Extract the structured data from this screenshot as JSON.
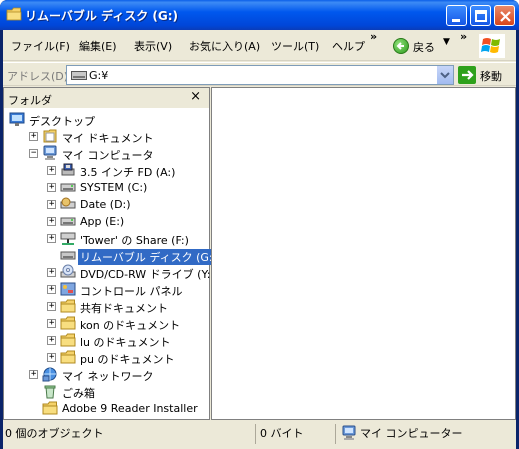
{
  "window": {
    "title": "リムーバブル ディスク (G:)"
  },
  "menu": {
    "items": [
      "ファイル(F)",
      "編集(E)",
      "表示(V)",
      "お気に入り(A)",
      "ツール(T)",
      "ヘルプ"
    ],
    "overflow_glyph": "»",
    "back_label": "戻る"
  },
  "address": {
    "label": "アドレス(D)",
    "value": "G:¥",
    "go_label": "移動"
  },
  "folders": {
    "title": "フォルダ",
    "close_glyph": "×",
    "tree": [
      {
        "label": "デスクトップ",
        "icon": "desktop-icon",
        "expander": ""
      },
      {
        "label": "マイ ドキュメント",
        "icon": "my-documents-icon",
        "expander": "+"
      },
      {
        "label": "マイ コンピュータ",
        "icon": "my-computer-icon",
        "expander": "−"
      },
      {
        "label": "3.5 インチ FD (A:)",
        "icon": "floppy-icon",
        "expander": "+"
      },
      {
        "label": "SYSTEM (C:)",
        "icon": "hard-drive-icon",
        "expander": "+"
      },
      {
        "label": "Date (D:)",
        "icon": "cd-drive-icon",
        "expander": "+"
      },
      {
        "label": "App (E:)",
        "icon": "hard-drive-icon",
        "expander": "+"
      },
      {
        "label": "'Tower' の Share (F:)",
        "icon": "network-drive-icon",
        "expander": "+"
      },
      {
        "label": "リムーバブル ディスク (G:)",
        "icon": "removable-disk-icon",
        "expander": ""
      },
      {
        "label": "DVD/CD-RW ドライブ (Y:)",
        "icon": "dvd-drive-icon",
        "expander": "+"
      },
      {
        "label": "コントロール パネル",
        "icon": "control-panel-icon",
        "expander": "+"
      },
      {
        "label": "共有ドキュメント",
        "icon": "folder-icon",
        "expander": "+"
      },
      {
        "label": "kon のドキュメント",
        "icon": "folder-icon",
        "expander": "+"
      },
      {
        "label": "lu のドキュメント",
        "icon": "folder-icon",
        "expander": "+"
      },
      {
        "label": "pu のドキュメント",
        "icon": "folder-icon",
        "expander": "+"
      },
      {
        "label": "マイ ネットワーク",
        "icon": "my-network-icon",
        "expander": "+"
      },
      {
        "label": "ごみ箱",
        "icon": "recycle-bin-icon",
        "expander": ""
      },
      {
        "label": "Adobe 9 Reader Installer",
        "icon": "folder-icon",
        "expander": ""
      }
    ]
  },
  "status": {
    "objects": "0 個のオブジェクト",
    "size": "0 バイト",
    "location": "マイ コンピューター"
  },
  "colors": {
    "title_bar": "#0058ee",
    "selection": "#316ac5",
    "frame": "#ece9d8"
  }
}
